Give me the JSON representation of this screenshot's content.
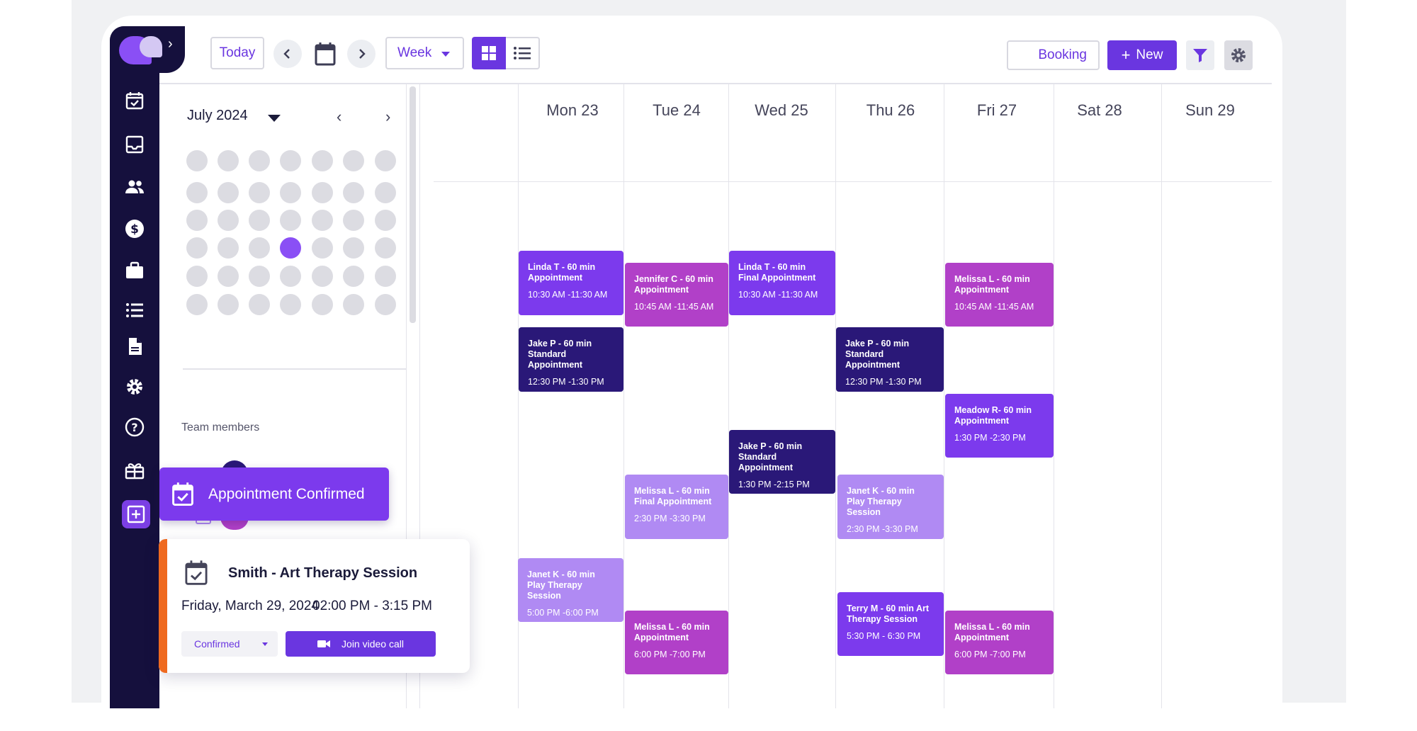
{
  "toolbar": {
    "today_label": "Today",
    "view_selected": "Week",
    "booking_label": "Booking",
    "new_label": "New"
  },
  "mini_calendar": {
    "month_label": "July 2024",
    "selected_week_row": 4,
    "selected_day_col": 3
  },
  "team": {
    "label": "Team members"
  },
  "week": {
    "days": [
      "Mon 23",
      "Tue 24",
      "Wed 25",
      "Thu 26",
      "Fri 27",
      "Sat 28",
      "Sun 29"
    ]
  },
  "appointments": [
    {
      "title": "Linda T - 60 min Appointment",
      "time": "10:30 AM -11:30 AM",
      "day": "Mon 23",
      "color": "purple"
    },
    {
      "title": "Jennifer C - 60 min Appointment",
      "time": "10:45 AM -11:45 AM",
      "day": "Tue 24",
      "color": "magenta"
    },
    {
      "title": "Linda T - 60 min Final Appointment",
      "time": "10:30 AM -11:30 AM",
      "day": "Wed 25",
      "color": "purple"
    },
    {
      "title": "Melissa L - 60 min Appointment",
      "time": "10:45 AM -11:45 AM",
      "day": "Fri 27",
      "color": "magenta"
    },
    {
      "title": "Jake P - 60 min Standard Appointment",
      "time": "12:30 PM -1:30 PM",
      "day": "Mon 23",
      "color": "navy"
    },
    {
      "title": "Jake P - 60 min Standard Appointment",
      "time": "12:30 PM -1:30 PM",
      "day": "Thu 26",
      "color": "navy"
    },
    {
      "title": "Meadow R- 60 min Appointment",
      "time": "1:30 PM -2:30 PM",
      "day": "Fri 27",
      "color": "purple"
    },
    {
      "title": "Jake P - 60 min Standard Appointment",
      "time": "1:30 PM -2:15 PM",
      "day": "Wed 25",
      "color": "navy"
    },
    {
      "title": "Melissa L - 60 min Final Appointment",
      "time": "2:30 PM -3:30 PM",
      "day": "Tue 24",
      "color": "light"
    },
    {
      "title": "Janet K - 60 min Play Therapy Session",
      "time": "2:30 PM -3:30 PM",
      "day": "Thu 26",
      "color": "light"
    },
    {
      "title": "Janet K - 60 min Play Therapy Session",
      "time": "5:00 PM -6:00 PM",
      "day": "Mon 23",
      "color": "light"
    },
    {
      "title": "Terry M - 60 min Art Therapy Session",
      "time": "5:30 PM - 6:30 PM",
      "day": "Thu 26",
      "color": "purple"
    },
    {
      "title": "Melissa L - 60 min Appointment",
      "time": "6:00 PM -7:00 PM",
      "day": "Tue 24",
      "color": "magenta"
    },
    {
      "title": "Melissa L - 60 min Appointment",
      "time": "6:00 PM -7:00 PM",
      "day": "Fri 27",
      "color": "magenta"
    }
  ],
  "toast": {
    "text": "Appointment Confirmed"
  },
  "detail_card": {
    "title": "Smith - Art Therapy Session",
    "date": "Friday, March 29, 2024",
    "time": "02:00 PM - 3:15 PM",
    "status": "Confirmed",
    "join_label": "Join video call",
    "accent_color": "#ef6a1f"
  },
  "colors": {
    "brand": "#6a36e0",
    "rail": "#15103d",
    "purple": "#7c3aed",
    "magenta": "#b140c8",
    "navy": "#2a1878",
    "light": "#b08af3"
  },
  "icons": {
    "rail": [
      "calendar-check-icon",
      "inbox-icon",
      "people-icon",
      "dollar-icon",
      "briefcase-icon",
      "list-icon",
      "document-icon",
      "gear-icon",
      "help-icon",
      "gift-icon",
      "add-icon"
    ]
  }
}
